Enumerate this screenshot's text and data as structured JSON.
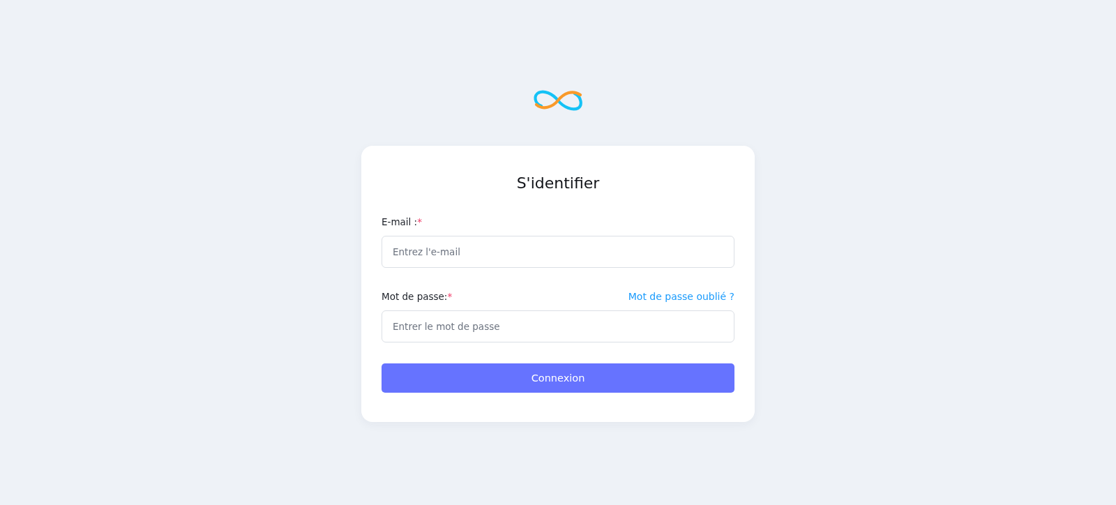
{
  "title": "S'identifier",
  "fields": [
    {
      "label": "E-mail :",
      "required_mark": "*",
      "placeholder": "Entrez l'e-mail"
    },
    {
      "label": "Mot de passe:",
      "required_mark": "*",
      "placeholder": "Entrer le mot de passe",
      "link": "Mot de passe oublié ?"
    }
  ],
  "submit_button": "Connexion"
}
